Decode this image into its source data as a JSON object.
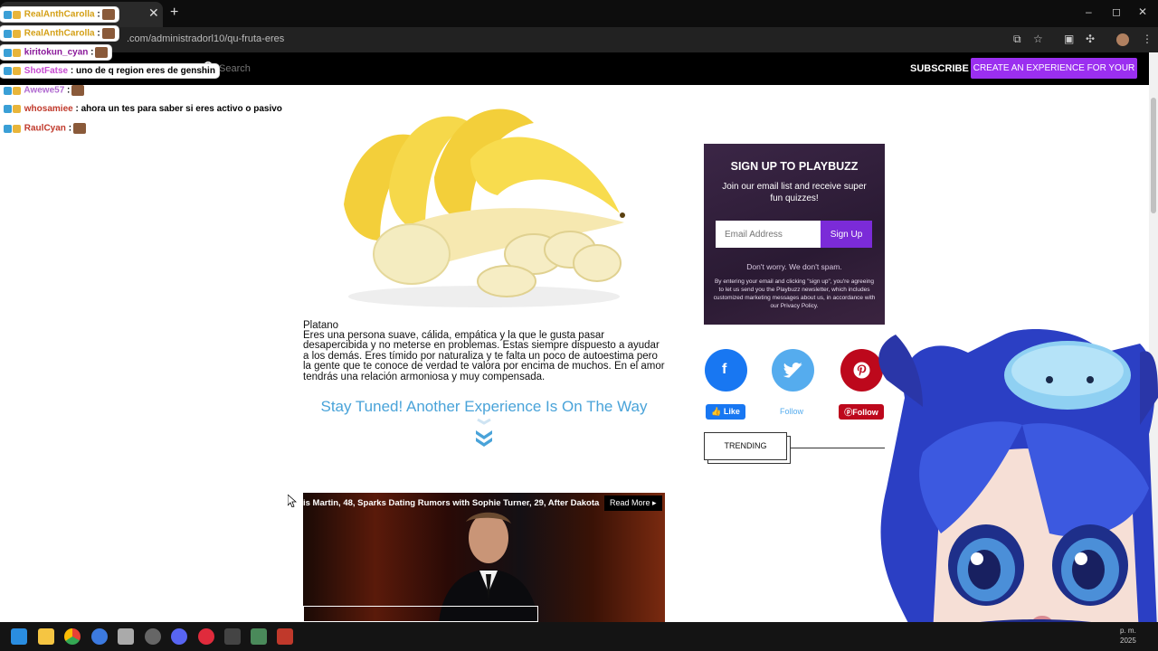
{
  "browser": {
    "tab_title": "",
    "new_tab_icon": "+",
    "url": ".com/administradorl10/qu-fruta-eres",
    "controls": {
      "minimize": "–",
      "restore": "◻",
      "close": "✕"
    }
  },
  "site_header": {
    "search_placeholder": "Search",
    "subscribe_label": "SUBSCRIBE",
    "create_label": "CREATE AN EXPERIENCE FOR YOUR SITE",
    "accent_color": "#9b2ff0"
  },
  "chat": [
    {
      "user": "RealAnthCarolla",
      "user_color": "#d4a017",
      "message": ":",
      "has_emote": true
    },
    {
      "user": "RealAnthCarolla",
      "user_color": "#d4a017",
      "message": ":",
      "has_emote": true
    },
    {
      "user": "kiritokun_cyan",
      "user_color": "#8b1a9b",
      "message": ":",
      "has_emote": true
    },
    {
      "user": "ShotFatse",
      "user_color": "#c74ad1",
      "message": ": uno de q region eres de genshin",
      "has_emote": false
    },
    {
      "user": "Awewe57",
      "user_color": "#b06ad0",
      "message": ":",
      "has_emote": true
    },
    {
      "user": "whosamiee",
      "user_color": "#c0392b",
      "message": ": ahora un tes para saber si eres activo o pasivo",
      "has_emote": false
    },
    {
      "user": "RaulCyan",
      "user_color": "#c0392b",
      "message": ":",
      "has_emote": true
    }
  ],
  "article": {
    "fruit_name": "Platano",
    "description": "Eres una persona suave, cálida, empática y la que le gusta pasar desapercibida y no meterse en problemas. Estas siempre dispuesto a ayudar a los demás. Eres tímido por naturaliza y te falta un poco de autoestima pero la gente que te conoce de verdad te valora por encima de muchos. En el amor tendrás una relación armoniosa y muy compensada.",
    "stay_tuned": "Stay Tuned! Another Experience Is On The Way",
    "stay_tuned_color": "#49a3d9"
  },
  "video": {
    "caption": "is Martin, 48, Sparks Dating Rumors with Sophie Turner, 29, After Dakota",
    "read_more": "Read More ▸"
  },
  "newsletter": {
    "title_prefix": "SIGN UP TO",
    "title_brand": "PLAYBUZZ",
    "subtitle": "Join our email list and receive super fun quizzes!",
    "email_placeholder": "Email Address",
    "signup_label": "Sign Up",
    "no_spam": "Don't worry. We don't spam.",
    "legal": "By entering your email and clicking \"sign up\", you're agreeing to let us send you the Playbuzz newsletter, which includes customized marketing messages about us, in accordance with our Privacy Policy."
  },
  "social": {
    "facebook_icon": "f",
    "facebook_label": "Like",
    "twitter_label": "Follow",
    "pinterest_label": "Follow",
    "facebook_color": "#1877f2",
    "twitter_color": "#55acee",
    "pinterest_color": "#bd081c"
  },
  "trending_label": "TRENDING",
  "taskbar": {
    "clock_time": "p. m.",
    "clock_date": "2025"
  }
}
